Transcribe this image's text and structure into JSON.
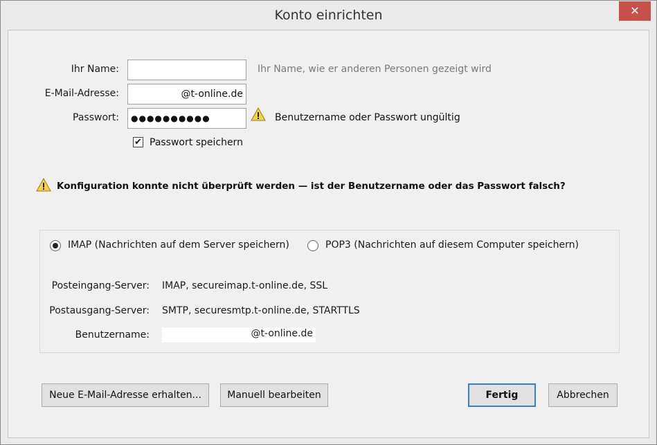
{
  "window": {
    "title": "Konto einrichten",
    "close_label": "✕"
  },
  "form": {
    "name_label": "Ihr Name:",
    "name_value": "",
    "name_hint": "Ihr Name, wie er anderen Personen gezeigt wird",
    "email_label": "E-Mail-Adresse:",
    "email_value": "@t-online.de",
    "password_label": "Passwort:",
    "password_value": "●●●●●●●●●●",
    "password_warning": "Benutzername oder Passwort ungültig",
    "save_password_label": "Passwort speichern",
    "save_password_checked": "✔"
  },
  "config_warning": "Konfiguration konnte nicht überprüft werden — ist der Benutzername oder das Passwort falsch?",
  "server": {
    "imap_label": "IMAP (Nachrichten auf dem Server speichern)",
    "pop3_label": "POP3 (Nachrichten auf diesem Computer speichern)",
    "incoming_label": "Posteingang-Server:",
    "incoming_value": "IMAP, secureimap.t-online.de, SSL",
    "outgoing_label": "Postausgang-Server:",
    "outgoing_value": "SMTP, securesmtp.t-online.de, STARTTLS",
    "username_label": "Benutzername:",
    "username_value": "@t-online.de"
  },
  "buttons": {
    "new_email": "Neue E-Mail-Adresse erhalten...",
    "manual_edit": "Manuell bearbeiten",
    "done": "Fertig",
    "cancel": "Abbrechen"
  }
}
